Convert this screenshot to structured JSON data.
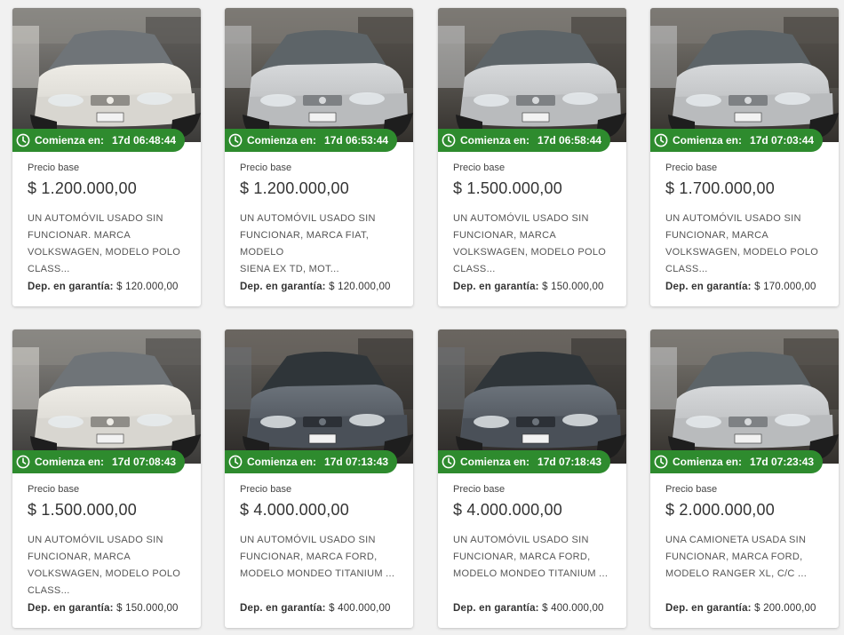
{
  "labels": {
    "countdown": "Comienza en:",
    "price_base": "Precio base",
    "deposit": "Dep. en garantía:"
  },
  "colors": {
    "accent_green": "#2e8b2e",
    "background": "#f1f1f1"
  },
  "cards": [
    {
      "countdown": "17d 06:48:44",
      "price": "$ 1.200.000,00",
      "description": [
        "UN AUTOMÓVIL USADO SIN",
        "FUNCIONAR. MARCA",
        "VOLKSWAGEN, MODELO POLO",
        "CLASS..."
      ],
      "deposit": "$ 120.000,00",
      "car_color": "white"
    },
    {
      "countdown": "17d 06:53:44",
      "price": "$ 1.200.000,00",
      "description": [
        "UN AUTOMÓVIL USADO SIN",
        "FUNCIONAR, MARCA FIAT, MODELO",
        "SIENA EX TD, MOT..."
      ],
      "deposit": "$ 120.000,00",
      "car_color": "silver"
    },
    {
      "countdown": "17d 06:58:44",
      "price": "$ 1.500.000,00",
      "description": [
        "UN AUTOMÓVIL USADO SIN",
        "FUNCIONAR, MARCA",
        "VOLKSWAGEN, MODELO POLO",
        "CLASS..."
      ],
      "deposit": "$ 150.000,00",
      "car_color": "silver"
    },
    {
      "countdown": "17d 07:03:44",
      "price": "$ 1.700.000,00",
      "description": [
        "UN AUTOMÓVIL USADO SIN",
        "FUNCIONAR, MARCA",
        "VOLKSWAGEN, MODELO POLO",
        "CLASS..."
      ],
      "deposit": "$ 170.000,00",
      "car_color": "silver"
    },
    {
      "countdown": "17d 07:08:43",
      "price": "$ 1.500.000,00",
      "description": [
        "UN AUTOMÓVIL USADO SIN",
        "FUNCIONAR, MARCA",
        "VOLKSWAGEN, MODELO POLO",
        "CLASS..."
      ],
      "deposit": "$ 150.000,00",
      "car_color": "white"
    },
    {
      "countdown": "17d 07:13:43",
      "price": "$ 4.000.000,00",
      "description": [
        "UN AUTOMÓVIL USADO SIN",
        "FUNCIONAR, MARCA FORD,",
        "MODELO MONDEO TITANIUM ..."
      ],
      "deposit": "$ 400.000,00",
      "car_color": "dark"
    },
    {
      "countdown": "17d 07:18:43",
      "price": "$ 4.000.000,00",
      "description": [
        "UN AUTOMÓVIL USADO SIN",
        "FUNCIONAR, MARCA FORD,",
        "MODELO MONDEO TITANIUM ..."
      ],
      "deposit": "$ 400.000,00",
      "car_color": "dark"
    },
    {
      "countdown": "17d 07:23:43",
      "price": "$ 2.000.000,00",
      "description": [
        "UNA CAMIONETA USADA SIN",
        "FUNCIONAR, MARCA FORD,",
        "MODELO RANGER XL, C/C ..."
      ],
      "deposit": "$ 200.000,00",
      "car_color": "silver"
    }
  ]
}
